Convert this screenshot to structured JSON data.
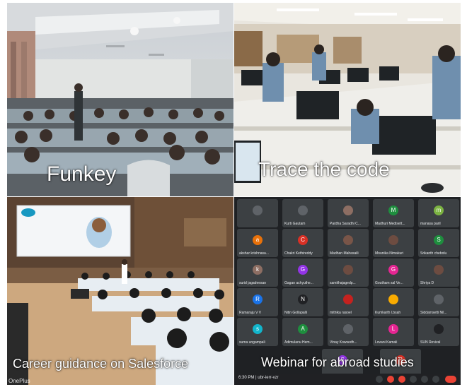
{
  "panels": [
    {
      "id": "funkey",
      "caption": "Funkey"
    },
    {
      "id": "trace",
      "caption": "Trace the code"
    },
    {
      "id": "salesforce",
      "caption": "Career guidance on Salesforce",
      "slide_title": "Learn Salesforce with Trailhead"
    },
    {
      "id": "webinar",
      "caption": "Webinar for abroad studies"
    }
  ],
  "watermark": "OnePlus",
  "meet": {
    "time": "6:30 PM | ubr-ierr-vzr",
    "tiles": [
      {
        "name": "",
        "initial": "",
        "color": "#5f6368"
      },
      {
        "name": "Kurti Gautam",
        "initial": "",
        "color": "#5f6368"
      },
      {
        "name": "Pardha Saradhi C...",
        "initial": "",
        "color": "#8d6e63"
      },
      {
        "name": "Madhuri Medisett...",
        "initial": "M",
        "color": "#1e8e3e"
      },
      {
        "name": "manasa paril",
        "initial": "m",
        "color": "#7cb342"
      },
      {
        "name": "akshar krishnasa...",
        "initial": "a",
        "color": "#e8710a"
      },
      {
        "name": "Chakri Kethireddy",
        "initial": "C",
        "color": "#d93025"
      },
      {
        "name": "Madhan Mahasaili",
        "initial": "",
        "color": "#795548"
      },
      {
        "name": "Mounika Nimakuri",
        "initial": "",
        "color": "#6d4c41"
      },
      {
        "name": "Srikanth chebolu",
        "initial": "S",
        "color": "#1e8e3e"
      },
      {
        "name": "surid jagadeesan",
        "initial": "k",
        "color": "#8d6e63"
      },
      {
        "name": "Gagan achyuthe...",
        "initial": "G",
        "color": "#9334e6"
      },
      {
        "name": "samithajagedp...",
        "initial": "",
        "color": "#6d4c41"
      },
      {
        "name": "Goutham sal Ve...",
        "initial": "G",
        "color": "#e52592"
      },
      {
        "name": "Shriya D",
        "initial": "",
        "color": "#6d4c41"
      },
      {
        "name": "Ramaraju V V",
        "initial": "R",
        "color": "#1a73e8"
      },
      {
        "name": "Nitin Gollapalli",
        "initial": "N",
        "color": "#202124"
      },
      {
        "name": "mithika rasoel",
        "initial": "",
        "color": "#c5221f"
      },
      {
        "name": "Kumkarth l.bsah",
        "initial": "",
        "color": "#f9ab00"
      },
      {
        "name": "Siddamsetti Nil...",
        "initial": "",
        "color": "#5f6368"
      },
      {
        "name": "suma ungampali",
        "initial": "s",
        "color": "#12b5cb"
      },
      {
        "name": "Adimulanu Hem...",
        "initial": "A",
        "color": "#1e8e3e"
      },
      {
        "name": "Vinay Kowsedh...",
        "initial": "",
        "color": "#5f6368"
      },
      {
        "name": "Lovani Kamali",
        "initial": "L",
        "color": "#e52592"
      },
      {
        "name": "SUN Revival",
        "initial": "",
        "color": "#202124"
      },
      {
        "name": "",
        "initial": "S",
        "color": "#9334e6"
      },
      {
        "name": "",
        "initial": "R",
        "color": "#d93025"
      }
    ]
  }
}
